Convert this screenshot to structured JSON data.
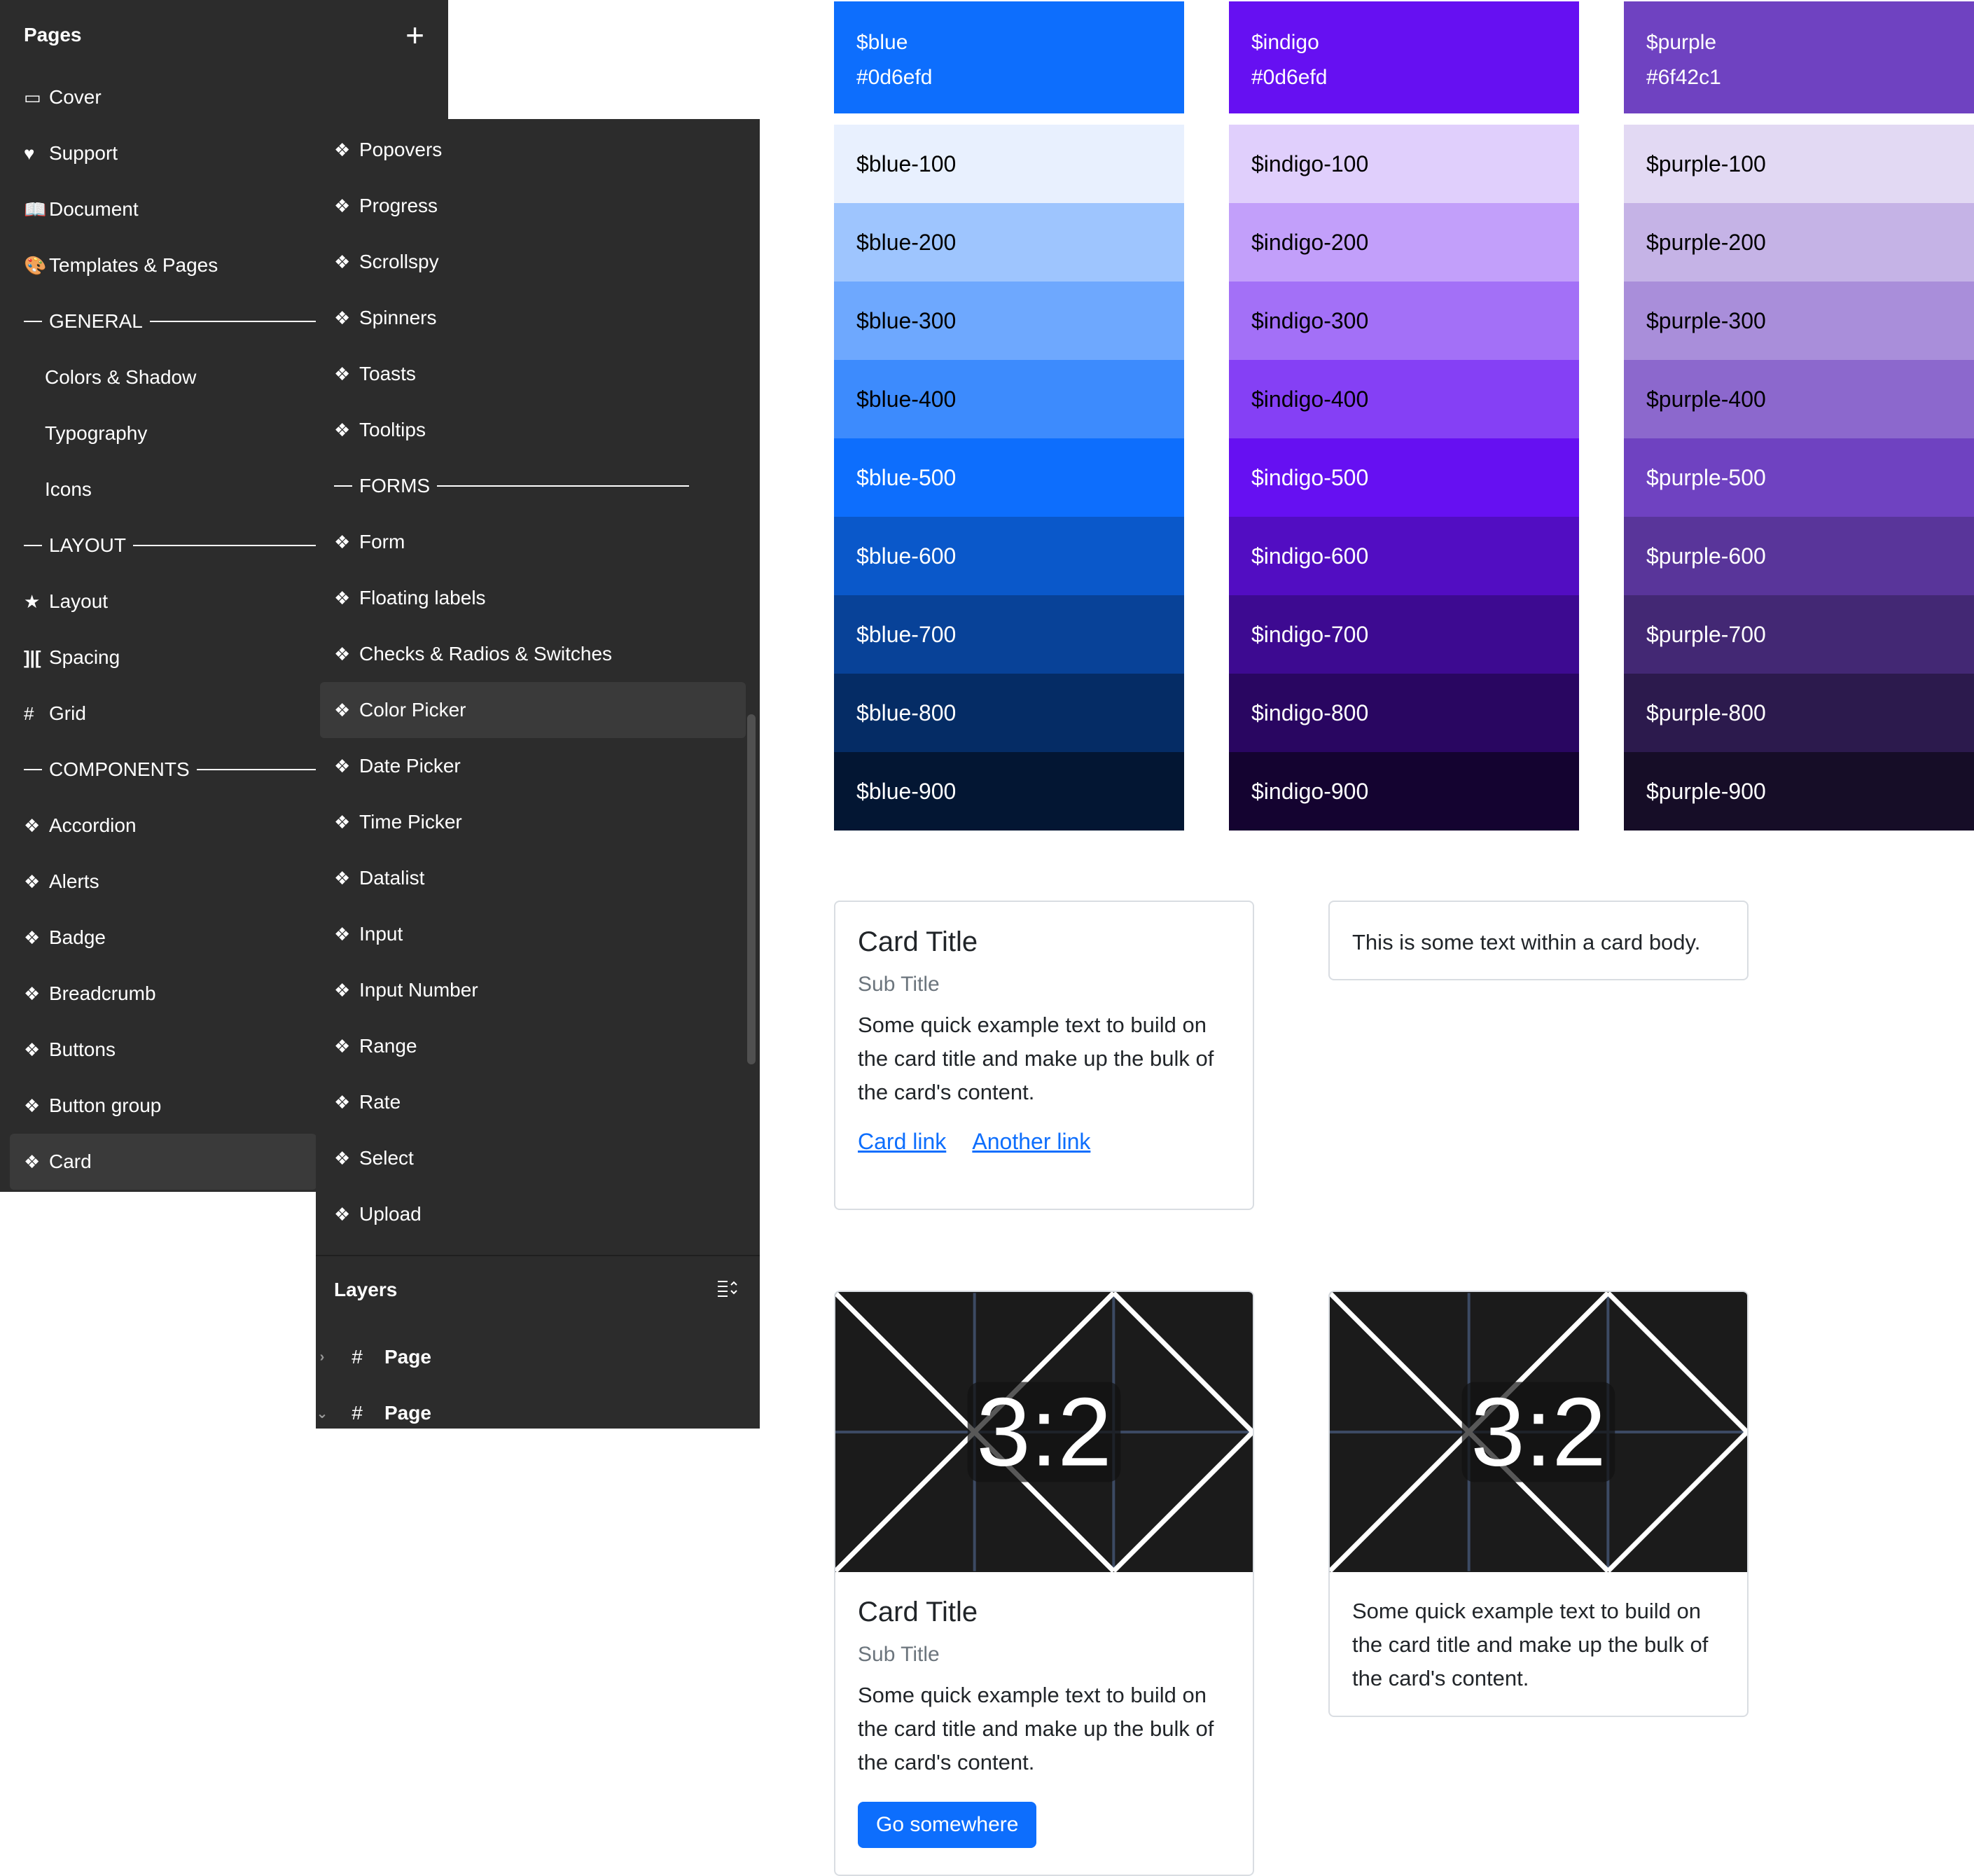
{
  "pages_panel": {
    "title": "Pages",
    "add_icon": "plus-icon",
    "items": [
      {
        "icon": "▭",
        "label": "Cover"
      },
      {
        "icon": "♥",
        "label": "Support"
      },
      {
        "icon": "📖",
        "label": "Document"
      },
      {
        "icon": "🎨",
        "label": "Templates & Pages"
      }
    ],
    "general": {
      "section": "GENERAL",
      "items": [
        "Colors & Shadow",
        "Typography",
        "Icons"
      ]
    },
    "layout": {
      "section": "LAYOUT",
      "items": [
        {
          "icon": "★",
          "label": "Layout"
        },
        {
          "icon": "]|[",
          "label": "Spacing"
        },
        {
          "icon": "#",
          "label": "Grid"
        }
      ]
    },
    "components": {
      "section": "COMPONENTS",
      "items": [
        "Accordion",
        "Alerts",
        "Badge",
        "Breadcrumb",
        "Buttons",
        "Button group",
        "Card"
      ],
      "active": "Card"
    }
  },
  "pages_panel_2": {
    "items_top": [
      "Popovers",
      "Progress",
      "Scrollspy",
      "Spinners",
      "Toasts",
      "Tooltips"
    ],
    "forms_section": "FORMS",
    "forms_items": [
      "Form",
      "Floating labels",
      "Checks & Radios & Switches",
      "Color Picker",
      "Date Picker",
      "Time Picker",
      "Datalist",
      "Input",
      "Input Number",
      "Range",
      "Rate",
      "Select",
      "Upload"
    ],
    "active": "Color Picker",
    "component_icon": "❖"
  },
  "layers_panel": {
    "title": "Layers",
    "collapse_icon": "collapse-layers-icon",
    "rows": [
      {
        "chevron": "›",
        "icon": "#",
        "label": "Page"
      },
      {
        "chevron": "⌄",
        "icon": "#",
        "label": "Page"
      }
    ]
  },
  "palettes": [
    {
      "name": "$blue",
      "hex": "#0d6efd",
      "base_color": "#0d6efd",
      "shades": [
        {
          "label": "$blue-100",
          "color": "#e8f0fe",
          "text": "#000000"
        },
        {
          "label": "$blue-200",
          "color": "#9ec5fe",
          "text": "#000000"
        },
        {
          "label": "$blue-300",
          "color": "#6ea8fe",
          "text": "#000000"
        },
        {
          "label": "$blue-400",
          "color": "#3d8bfd",
          "text": "#000000"
        },
        {
          "label": "$blue-500",
          "color": "#0d6efd",
          "text": "#ffffff"
        },
        {
          "label": "$blue-600",
          "color": "#0a58ca",
          "text": "#ffffff"
        },
        {
          "label": "$blue-700",
          "color": "#084298",
          "text": "#ffffff"
        },
        {
          "label": "$blue-800",
          "color": "#052c65",
          "text": "#ffffff"
        },
        {
          "label": "$blue-900",
          "color": "#031633",
          "text": "#ffffff"
        }
      ]
    },
    {
      "name": "$indigo",
      "hex": "#0d6efd",
      "base_color": "#6610f2",
      "shades": [
        {
          "label": "$indigo-100",
          "color": "#e0cffc",
          "text": "#000000"
        },
        {
          "label": "$indigo-200",
          "color": "#c29ffa",
          "text": "#000000"
        },
        {
          "label": "$indigo-300",
          "color": "#a370f7",
          "text": "#000000"
        },
        {
          "label": "$indigo-400",
          "color": "#8540f5",
          "text": "#000000"
        },
        {
          "label": "$indigo-500",
          "color": "#6610f2",
          "text": "#ffffff"
        },
        {
          "label": "$indigo-600",
          "color": "#520dc2",
          "text": "#ffffff"
        },
        {
          "label": "$indigo-700",
          "color": "#3d0a91",
          "text": "#ffffff"
        },
        {
          "label": "$indigo-800",
          "color": "#290661",
          "text": "#ffffff"
        },
        {
          "label": "$indigo-900",
          "color": "#140330",
          "text": "#ffffff"
        }
      ]
    },
    {
      "name": "$purple",
      "hex": "#6f42c1",
      "base_color": "#6f42c1",
      "shades": [
        {
          "label": "$purple-100",
          "color": "#e2d9f3",
          "text": "#000000"
        },
        {
          "label": "$purple-200",
          "color": "#c5b3e6",
          "text": "#000000"
        },
        {
          "label": "$purple-300",
          "color": "#a98eda",
          "text": "#000000"
        },
        {
          "label": "$purple-400",
          "color": "#8c68cd",
          "text": "#000000"
        },
        {
          "label": "$purple-500",
          "color": "#6f42c1",
          "text": "#ffffff"
        },
        {
          "label": "$purple-600",
          "color": "#59359a",
          "text": "#ffffff"
        },
        {
          "label": "$purple-700",
          "color": "#432874",
          "text": "#ffffff"
        },
        {
          "label": "$purple-800",
          "color": "#2c1a4d",
          "text": "#ffffff"
        },
        {
          "label": "$purple-900",
          "color": "#160d27",
          "text": "#ffffff"
        }
      ]
    }
  ],
  "cards": {
    "card1": {
      "title": "Card Title",
      "subtitle": "Sub Title",
      "text": "Some quick example text to build on the card title and make up the bulk of the card's content.",
      "link1": "Card link",
      "link2": "Another link"
    },
    "card2": {
      "text": "This is some text within a card body."
    },
    "card3": {
      "image_label": "3:2",
      "title": "Card Title",
      "subtitle": "Sub Title",
      "text": "Some quick example text to build on the card title and make up the bulk of the card's content.",
      "button": "Go somewhere"
    },
    "card4": {
      "image_label": "3:2",
      "text": "Some quick example text to build on the card title and make up the bulk of the card's content."
    }
  },
  "colors": {
    "panel_bg": "#2c2c2c",
    "link": "#0d6efd",
    "button": "#0d6efd"
  }
}
